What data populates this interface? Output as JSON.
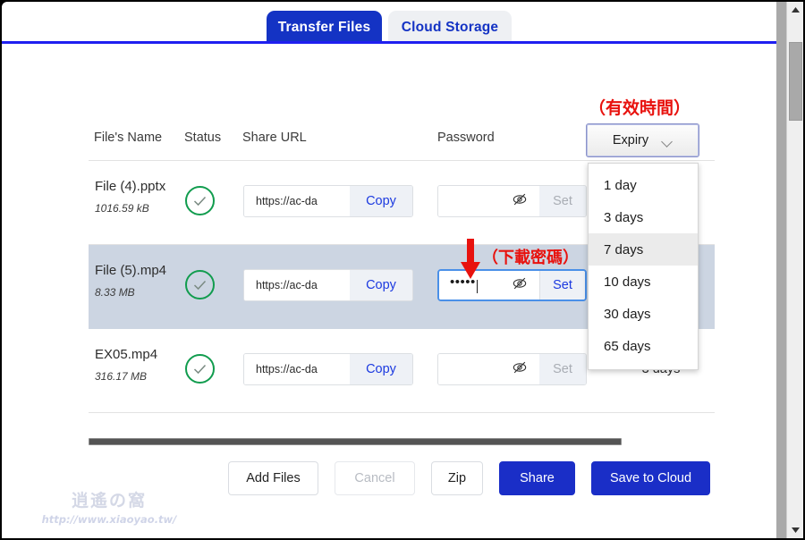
{
  "tabs": [
    {
      "label": "Transfer Files",
      "active": true
    },
    {
      "label": "Cloud Storage",
      "active": false
    }
  ],
  "table": {
    "headers": {
      "name": "File's Name",
      "status": "Status",
      "url": "Share URL",
      "password": "Password"
    },
    "rows": [
      {
        "name": "File (4).pptx",
        "size": "1016.59 kB",
        "status_icon": "check-circle-icon",
        "url_value": "https://ac-da",
        "copy_label": "Copy",
        "password_value": "",
        "password_icon": "eye-off-icon",
        "set_label": "Set",
        "set_enabled": false,
        "password_focused": false,
        "expiry": "",
        "selected": false
      },
      {
        "name": "File (5).mp4",
        "size": "8.33 MB",
        "status_icon": "check-circle-icon",
        "url_value": "https://ac-da",
        "copy_label": "Copy",
        "password_value": "•••••",
        "password_icon": "eye-off-icon",
        "set_label": "Set",
        "set_enabled": true,
        "password_focused": true,
        "expiry": "",
        "selected": true
      },
      {
        "name": "EX05.mp4",
        "size": "316.17 MB",
        "status_icon": "check-circle-icon",
        "url_value": "https://ac-da",
        "copy_label": "Copy",
        "password_value": "",
        "password_icon": "eye-off-icon",
        "set_label": "Set",
        "set_enabled": false,
        "password_focused": false,
        "expiry": "3 days",
        "selected": false
      }
    ]
  },
  "expiry": {
    "button_label": "Expiry",
    "options": [
      {
        "label": "1 day",
        "highlighted": false
      },
      {
        "label": "3 days",
        "highlighted": false
      },
      {
        "label": "7 days",
        "highlighted": true
      },
      {
        "label": "10 days",
        "highlighted": false
      },
      {
        "label": "30 days",
        "highlighted": false
      },
      {
        "label": "65 days",
        "highlighted": false
      }
    ]
  },
  "footer": {
    "buttons": [
      {
        "label": "Add Files",
        "style": "light"
      },
      {
        "label": "Cancel",
        "style": "disabled"
      },
      {
        "label": "Zip",
        "style": "light"
      },
      {
        "label": "Share",
        "style": "primary"
      },
      {
        "label": "Save to Cloud",
        "style": "primary"
      }
    ]
  },
  "annotations": {
    "expiry_note": "（有效時間）",
    "password_note": "（下載密碼）",
    "arrow_color": "#e8120e"
  },
  "watermark": {
    "title": "逍遙の窩",
    "url": "http://www.xiaoyao.tw/"
  },
  "colors": {
    "accent": "#1433c4",
    "primary_button": "#1a2ec7",
    "status_green": "#119c4e",
    "row_selected": "#ccd5e2",
    "annotation_red": "#e8120e"
  }
}
